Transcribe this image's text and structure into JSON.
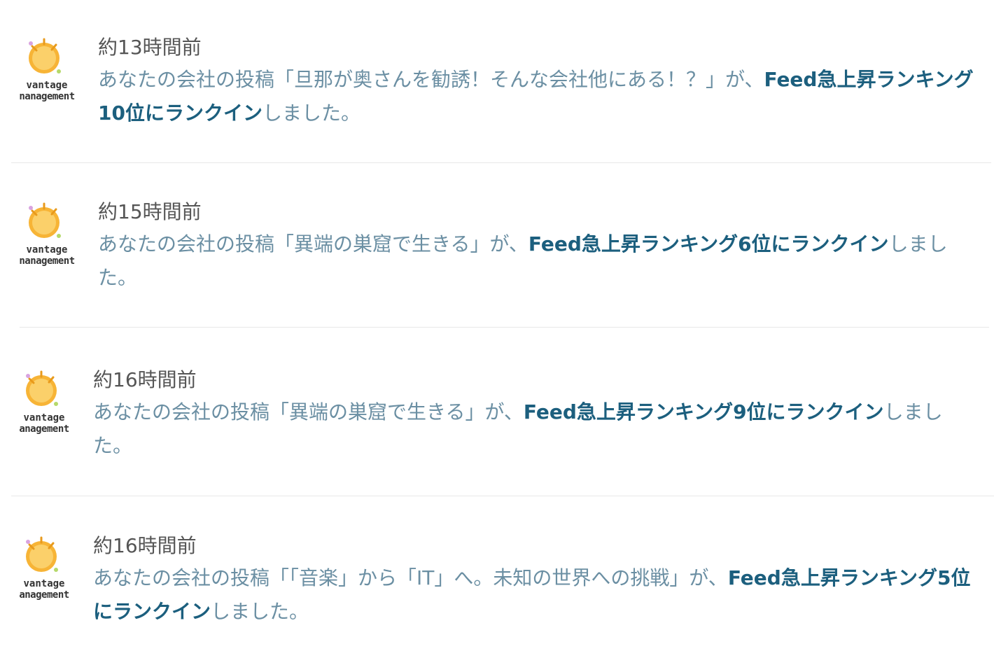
{
  "colors": {
    "time_text": "#555555",
    "message_text": "#6b8fa3",
    "link_text": "#1c5f7e",
    "divider": "#e8e8e8",
    "sun": "#f5a623"
  },
  "avatar": {
    "icon": "sun-logo-icon",
    "logo_line1": "vantage",
    "logo_line2_variants": [
      "nanagement",
      "anagement"
    ]
  },
  "feed": [
    {
      "time": "約13時間前",
      "prefix": "あなたの会社の投稿「旦那が奥さんを勧誘！そんな会社他にある！？」が、",
      "link": "Feed急上昇ランキング10位にランクイン",
      "suffix": "しました。"
    },
    {
      "time": "約15時間前",
      "prefix": "あなたの会社の投稿「異端の巣窟で生きる」が、",
      "link": "Feed急上昇ランキング6位にランクイン",
      "suffix": "しました。"
    },
    {
      "time": "約16時間前",
      "prefix": "あなたの会社の投稿「異端の巣窟で生きる」が、",
      "link": "Feed急上昇ランキング9位にランクイン",
      "suffix": "しました。"
    },
    {
      "time": "約16時間前",
      "prefix": "あなたの会社の投稿「「音楽」から「IT」へ。未知の世界への挑戦」が、",
      "link": "Feed急上昇ランキング5位にランクイン",
      "suffix": "しました。"
    }
  ]
}
